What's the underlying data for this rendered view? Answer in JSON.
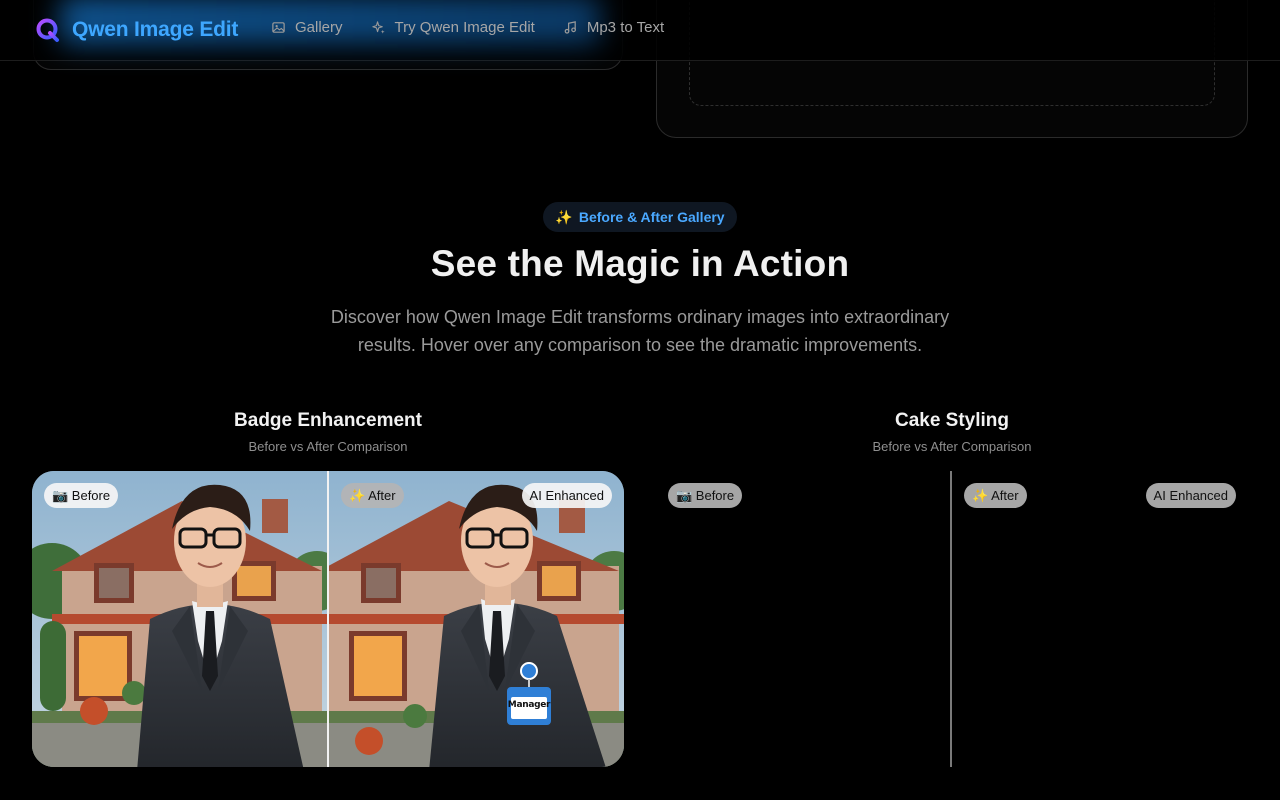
{
  "brand": {
    "name": "Qwen Image Edit"
  },
  "nav": {
    "items": [
      {
        "label": "Gallery",
        "icon": "gallery-icon"
      },
      {
        "label": "Try Qwen Image Edit",
        "icon": "sparkles-icon"
      },
      {
        "label": "Mp3 to Text",
        "icon": "music-note-icon"
      }
    ]
  },
  "section": {
    "badge_icon": "✨",
    "badge": "Before & After Gallery",
    "title": "See the Magic in Action",
    "subtitle": "Discover how Qwen Image Edit transforms ordinary images into extraordinary results. Hover over any comparison to see the dramatic improvements."
  },
  "cards": [
    {
      "title": "Badge Enhancement",
      "subtitle": "Before vs After Comparison",
      "before_label": "📷 Before",
      "after_label": "✨ After",
      "ai_label": "AI Enhanced",
      "badge_text": "Manager"
    },
    {
      "title": "Cake Styling",
      "subtitle": "Before vs After Comparison",
      "before_label": "📷 Before",
      "after_label": "✨ After",
      "ai_label": "AI Enhanced"
    }
  ],
  "colors": {
    "accent": "#3ea7ff",
    "background": "#000000",
    "logo_gradient_start": "#a347ff",
    "logo_gradient_end": "#3b5bff"
  }
}
